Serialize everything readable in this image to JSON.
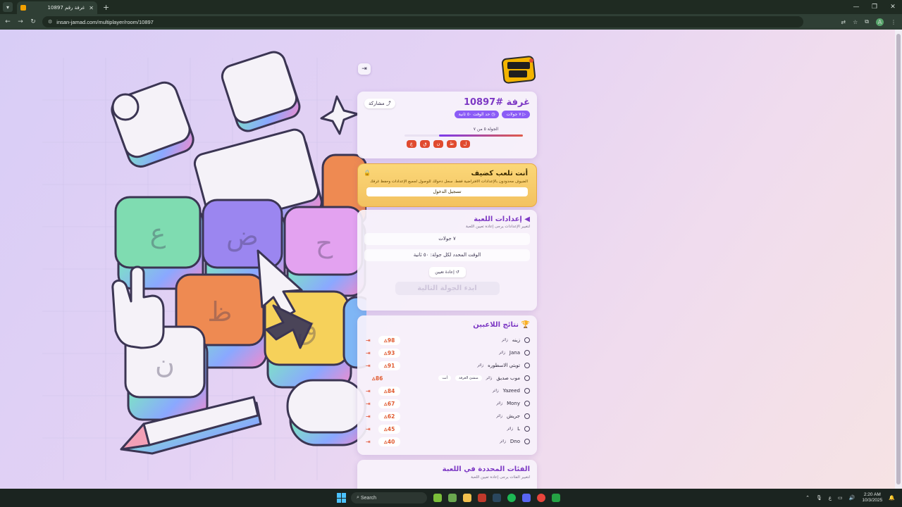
{
  "browser": {
    "tab_title": "غرفة رقم 10897",
    "tab_close": "✕",
    "new_tab": "+",
    "url": "insan-jamad.com/multiplayer/room/10897",
    "window_controls": [
      "—",
      "❐",
      "✕"
    ],
    "nav": {
      "back": "←",
      "forward": "→",
      "reload": "↻"
    },
    "profile_initial": "A"
  },
  "page": {
    "exit_icon": "⇥",
    "room": {
      "title": "غرفة #10897",
      "share_label": "مشاركة",
      "pills": [
        "▷ ٧ جولات",
        "◷ حد الوقت ٥٠ ثانية"
      ],
      "round_label": "الجولة ٥ من ٧",
      "progress": 0.71,
      "letters": [
        "ل",
        "ط",
        "ن",
        "ق",
        "ع"
      ]
    },
    "guest": {
      "title": "أنت تلعب كضيف",
      "text": "الضيوف محدودون بالإعدادات الافتراضية فقط. سجل دخولك للوصول لجميع الإعدادات وحفظ غرفك",
      "login_label": "تسجيل الدخول"
    },
    "settings": {
      "title": "◀ إعدادات اللعبة",
      "subtitle": "لتغيير الإعدادات يرجى إعادة تعيين اللعبة",
      "rounds": "٧ جولات",
      "time": "الوقت المحدد لكل جولة: ٥٠ ثانية",
      "reset_label": "↺ إعادة تعيين",
      "next_label": "ابدء الجولة التالية"
    },
    "results": {
      "title": "🏆 نتائج اللاعبين",
      "status_text": "زائر",
      "players": [
        {
          "name": "زينه",
          "score": "98"
        },
        {
          "name": "Jana",
          "score": "93"
        },
        {
          "name": "توبتي الاسطوره",
          "score": "91"
        },
        {
          "name": "موب صديق",
          "score": "86",
          "tags": [
            "منشئ الغرفة",
            "أنت"
          ],
          "self": true
        },
        {
          "name": "Yazeed",
          "score": "84"
        },
        {
          "name": "Mony",
          "score": "67"
        },
        {
          "name": "جريش",
          "score": "62"
        },
        {
          "name": "L",
          "score": "45"
        },
        {
          "name": "Dno",
          "score": "40"
        }
      ]
    },
    "categories": {
      "title": "الفئات المحددة في اللعبة",
      "subtitle": "لتغيير الفئات يرجى إعادة تعيين اللعبة"
    },
    "keys": [
      "ع",
      "ض",
      "ح",
      "ظ",
      "ق",
      "ن"
    ]
  },
  "taskbar": {
    "search_placeholder": "Search",
    "lang": "ع",
    "time": "2:20 AM",
    "date": "10/3/2025"
  }
}
